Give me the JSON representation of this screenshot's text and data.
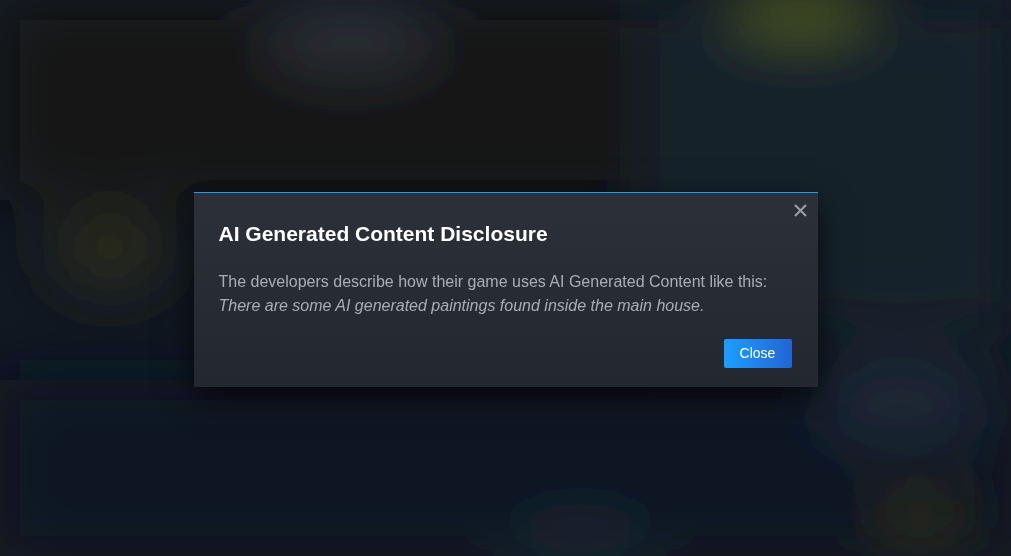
{
  "dialog": {
    "title": "AI Generated Content Disclosure",
    "description": "The developers describe how their game uses AI Generated Content like this:",
    "quote": "There are some AI generated paintings found inside the main house.",
    "buttons": [
      "Close"
    ]
  }
}
